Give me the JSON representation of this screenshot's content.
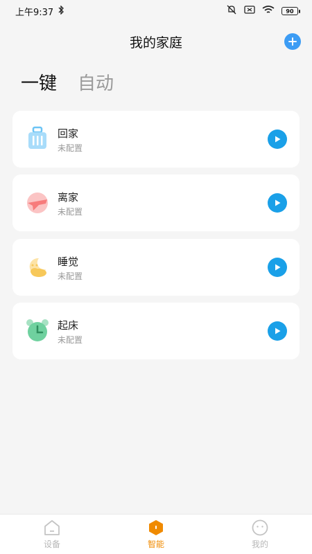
{
  "status_bar": {
    "time": "上午9:37",
    "battery": "90"
  },
  "header": {
    "title": "我的家庭"
  },
  "tabs": [
    {
      "label": "一键",
      "active": true
    },
    {
      "label": "自动",
      "active": false
    }
  ],
  "scenes": [
    {
      "title": "回家",
      "status": "未配置",
      "icon": "luggage-icon",
      "color": "#6cc4f5"
    },
    {
      "title": "离家",
      "status": "未配置",
      "icon": "airplane-icon",
      "color": "#f77c7c"
    },
    {
      "title": "睡觉",
      "status": "未配置",
      "icon": "moon-cloud-icon",
      "color": "#f7c85a"
    },
    {
      "title": "起床",
      "status": "未配置",
      "icon": "alarm-clock-icon",
      "color": "#4cc48a"
    }
  ],
  "bottom_nav": [
    {
      "label": "设备",
      "active": false
    },
    {
      "label": "智能",
      "active": true
    },
    {
      "label": "我的",
      "active": false
    }
  ],
  "colors": {
    "accent_blue": "#1aa0e8",
    "active_nav": "#f08a00"
  }
}
